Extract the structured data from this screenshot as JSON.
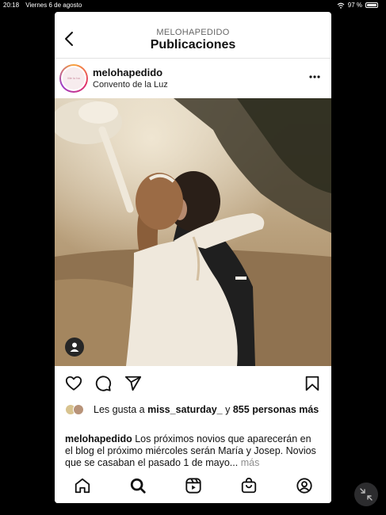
{
  "status_bar": {
    "time": "20:18",
    "date": "Viernes 6 de agosto",
    "battery": "97 %",
    "battery_level": 0.97,
    "icons": [
      "wifi-icon",
      "battery-icon"
    ]
  },
  "header": {
    "username": "MELOHAPEDIDO",
    "title": "Publicaciones",
    "back_icon": "chevron-left-icon"
  },
  "post": {
    "username": "melohapedido",
    "location": "Convento de la Luz",
    "avatar_text": "Me lo ha pedido",
    "menu_icon": "more-horizontal-icon",
    "image_icon": "user-tag-icon",
    "actions": [
      "heart-icon",
      "comment-icon",
      "share-icon",
      "bookmark-icon"
    ],
    "likes": {
      "prefix": "Les gusta a",
      "user": "miss_saturday_",
      "joiner": "y",
      "others": "855 personas más"
    },
    "caption": {
      "user": "melohapedido",
      "text": "Los próximos novios que aparecerán en el blog el próximo miércoles serán María y Josep. Novios que se casaban el pasado 1 de mayo...",
      "more": "más"
    }
  },
  "nav": [
    "home-icon",
    "search-icon",
    "reels-icon",
    "shop-icon",
    "profile-icon"
  ],
  "colors": {
    "background": "#000000",
    "card": "#ffffff",
    "text": "#111111",
    "muted": "#8e8e8e",
    "story_ring": "#e1306c"
  }
}
